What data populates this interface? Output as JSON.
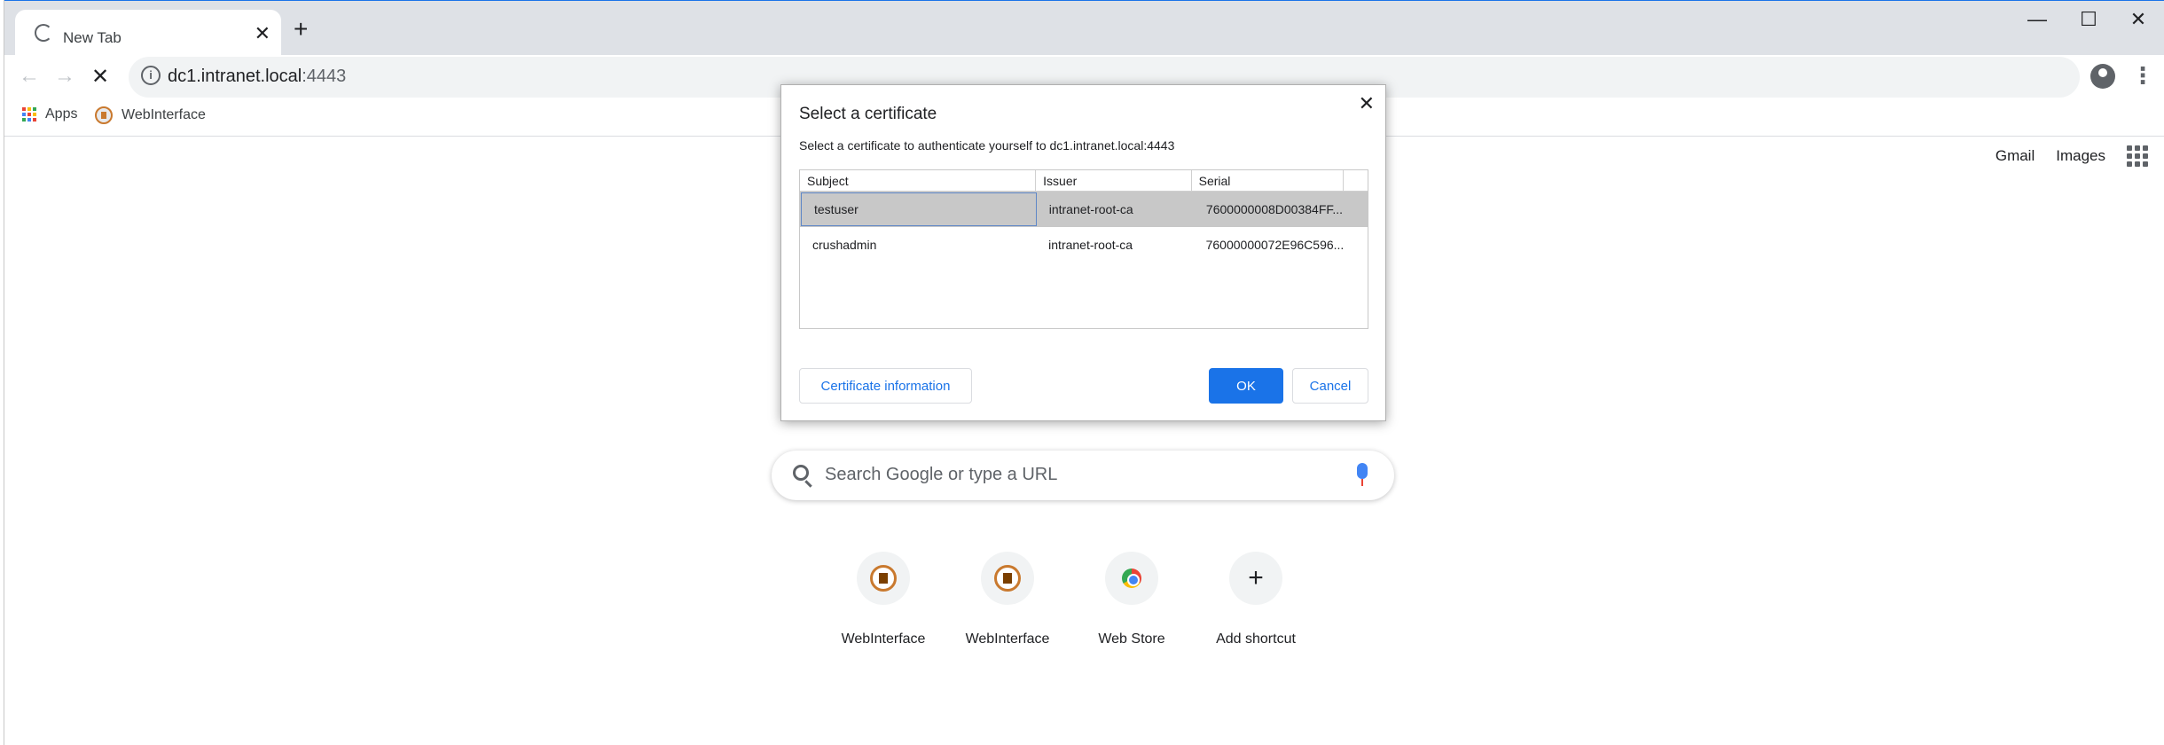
{
  "window": {
    "tab_title": "New Tab",
    "new_tab": "+",
    "minimize": "—",
    "maximize": "☐",
    "close": "✕"
  },
  "toolbar": {
    "url_host": "dc1.intranet.local",
    "url_port": ":4443",
    "back": "←",
    "forward": "→",
    "stop": "✕",
    "star": "☆",
    "menu": "⋮"
  },
  "bookmarks": [
    {
      "label": "Apps"
    },
    {
      "label": "WebInterface"
    }
  ],
  "ntp": {
    "links": [
      "Gmail",
      "Images"
    ],
    "search_placeholder": "Search Google or type a URL",
    "shortcuts": [
      {
        "label": "WebInterface",
        "icon": "webinterface-icon"
      },
      {
        "label": "WebInterface",
        "icon": "webinterface-icon"
      },
      {
        "label": "Web Store",
        "icon": "chrome-webstore-icon"
      },
      {
        "label": "Add shortcut",
        "icon": "plus-icon"
      }
    ]
  },
  "dialog": {
    "title": "Select a certificate",
    "description": "Select a certificate to authenticate yourself to dc1.intranet.local:4443",
    "close": "✕",
    "columns": [
      "Subject",
      "Issuer",
      "Serial"
    ],
    "rows": [
      {
        "subject": "testuser",
        "issuer": "intranet-root-ca",
        "serial": "7600000008D00384FF...",
        "selected": true
      },
      {
        "subject": "crushadmin",
        "issuer": "intranet-root-ca",
        "serial": "76000000072E96C596...",
        "selected": false
      }
    ],
    "info_button": "Certificate information",
    "ok_button": "OK",
    "cancel_button": "Cancel"
  },
  "colors": {
    "accent": "#1a73e8",
    "selected_row": "#c8c8c8",
    "tabstrip": "#dee1e6"
  }
}
